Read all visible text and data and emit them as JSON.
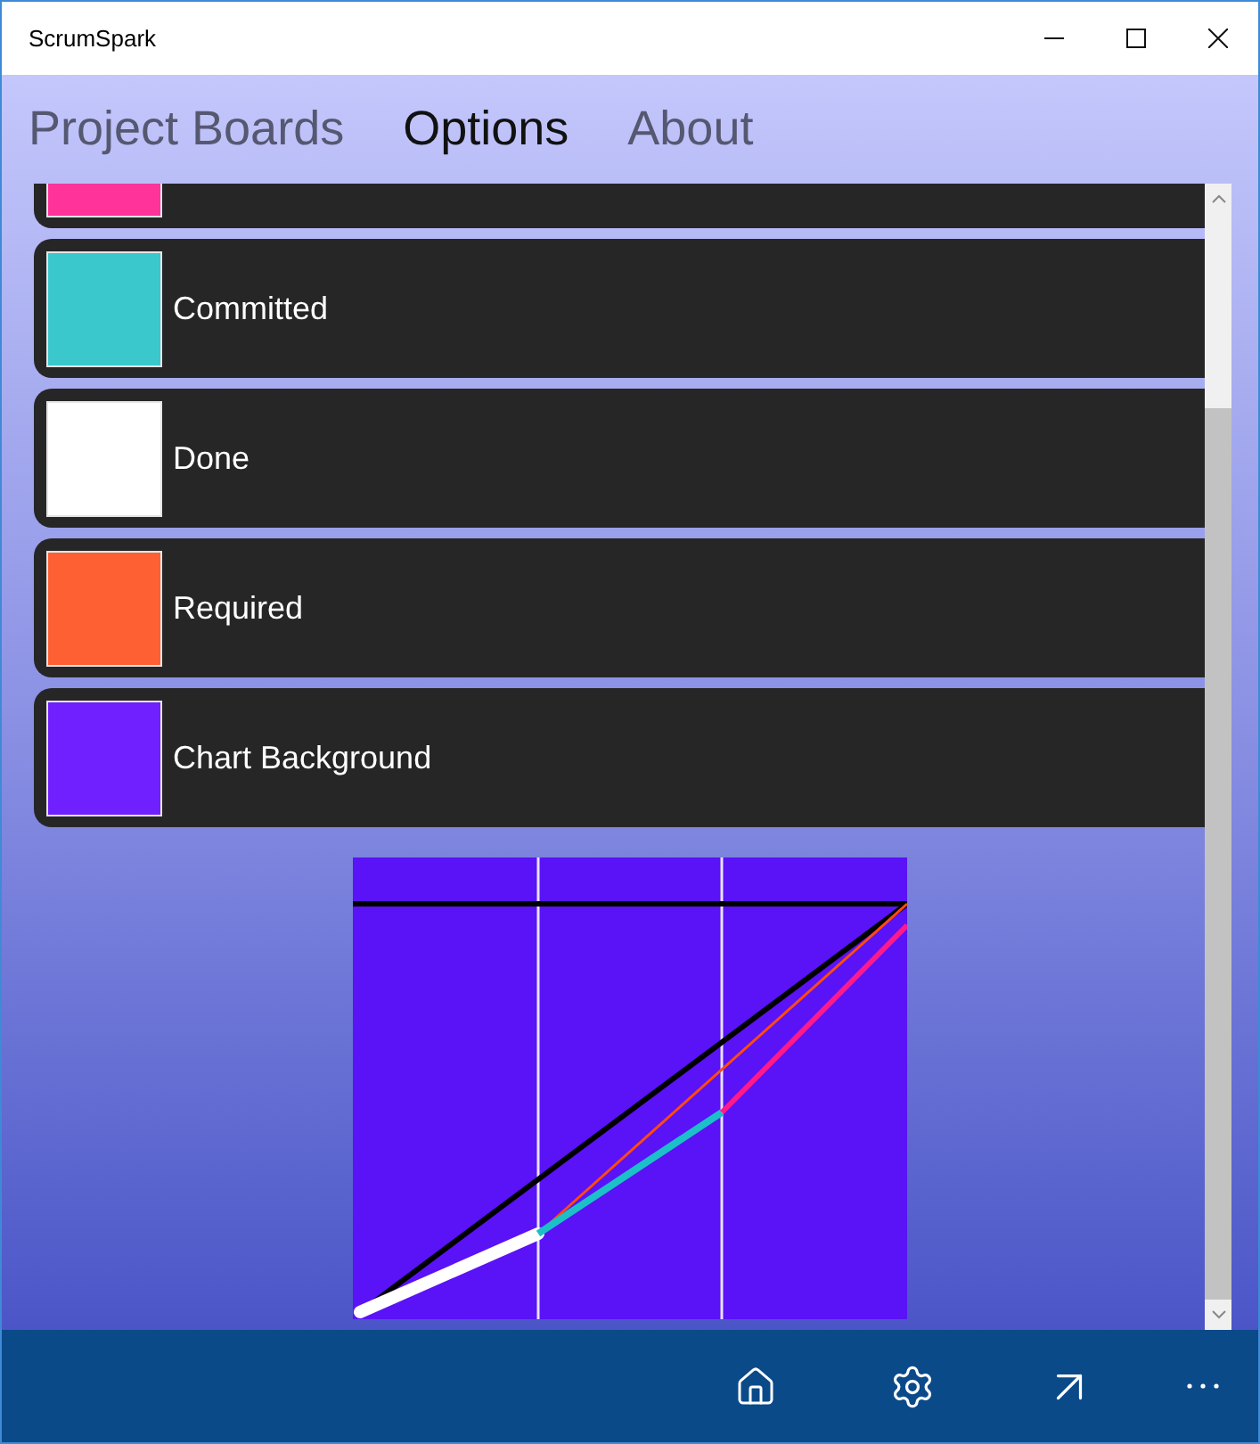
{
  "window": {
    "title": "ScrumSpark"
  },
  "tabs": [
    {
      "label": "Project Boards",
      "selected": false
    },
    {
      "label": "Options",
      "selected": true
    },
    {
      "label": "About",
      "selected": false
    }
  ],
  "color_settings": [
    {
      "color": "#ff3399"
    },
    {
      "label": "Committed",
      "color": "#3ac8cc"
    },
    {
      "label": "Done",
      "color": "#ffffff"
    },
    {
      "label": "Required",
      "color": "#ff6033"
    },
    {
      "label": "Chart Background",
      "color": "#7020ff"
    }
  ]
}
